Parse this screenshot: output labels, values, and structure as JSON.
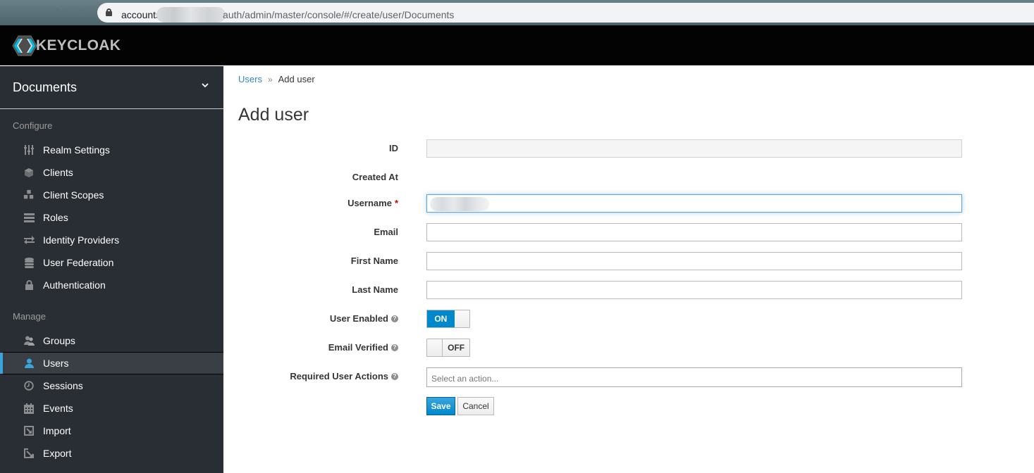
{
  "browser": {
    "url_host": "accounts",
    "url_path": "auth/admin/master/console/#/create/user/Documents"
  },
  "header": {
    "brand": "KEYCLOAK"
  },
  "sidebar": {
    "realm": "Documents",
    "configure_label": "Configure",
    "configure_items": [
      {
        "label": "Realm Settings",
        "icon": "sliders-icon"
      },
      {
        "label": "Clients",
        "icon": "cube-icon"
      },
      {
        "label": "Client Scopes",
        "icon": "cubes-icon"
      },
      {
        "label": "Roles",
        "icon": "server-icon"
      },
      {
        "label": "Identity Providers",
        "icon": "exchange-icon"
      },
      {
        "label": "User Federation",
        "icon": "database-icon"
      },
      {
        "label": "Authentication",
        "icon": "lock-icon"
      }
    ],
    "manage_label": "Manage",
    "manage_items": [
      {
        "label": "Groups",
        "icon": "users-icon"
      },
      {
        "label": "Users",
        "icon": "user-icon",
        "active": true
      },
      {
        "label": "Sessions",
        "icon": "clock-icon"
      },
      {
        "label": "Events",
        "icon": "calendar-icon"
      },
      {
        "label": "Import",
        "icon": "import-icon"
      },
      {
        "label": "Export",
        "icon": "export-icon"
      }
    ]
  },
  "main": {
    "breadcrumb": {
      "parent": "Users",
      "separator": "»",
      "current": "Add user"
    },
    "title": "Add user",
    "form": {
      "id_label": "ID",
      "id_value": "",
      "created_at_label": "Created At",
      "username_label": "Username",
      "username_required": "*",
      "email_label": "Email",
      "email_value": "",
      "first_name_label": "First Name",
      "first_name_value": "",
      "last_name_label": "Last Name",
      "last_name_value": "",
      "user_enabled_label": "User Enabled",
      "user_enabled_state": "ON",
      "email_verified_label": "Email Verified",
      "email_verified_state": "OFF",
      "required_actions_label": "Required User Actions",
      "required_actions_placeholder": "Select an action...",
      "help_glyph": "?",
      "save_label": "Save",
      "cancel_label": "Cancel"
    }
  },
  "colors": {
    "accent": "#0088ce",
    "link": "#2f87c6",
    "sidebar_bg": "#292e34",
    "active_indicator": "#39a5dc"
  }
}
